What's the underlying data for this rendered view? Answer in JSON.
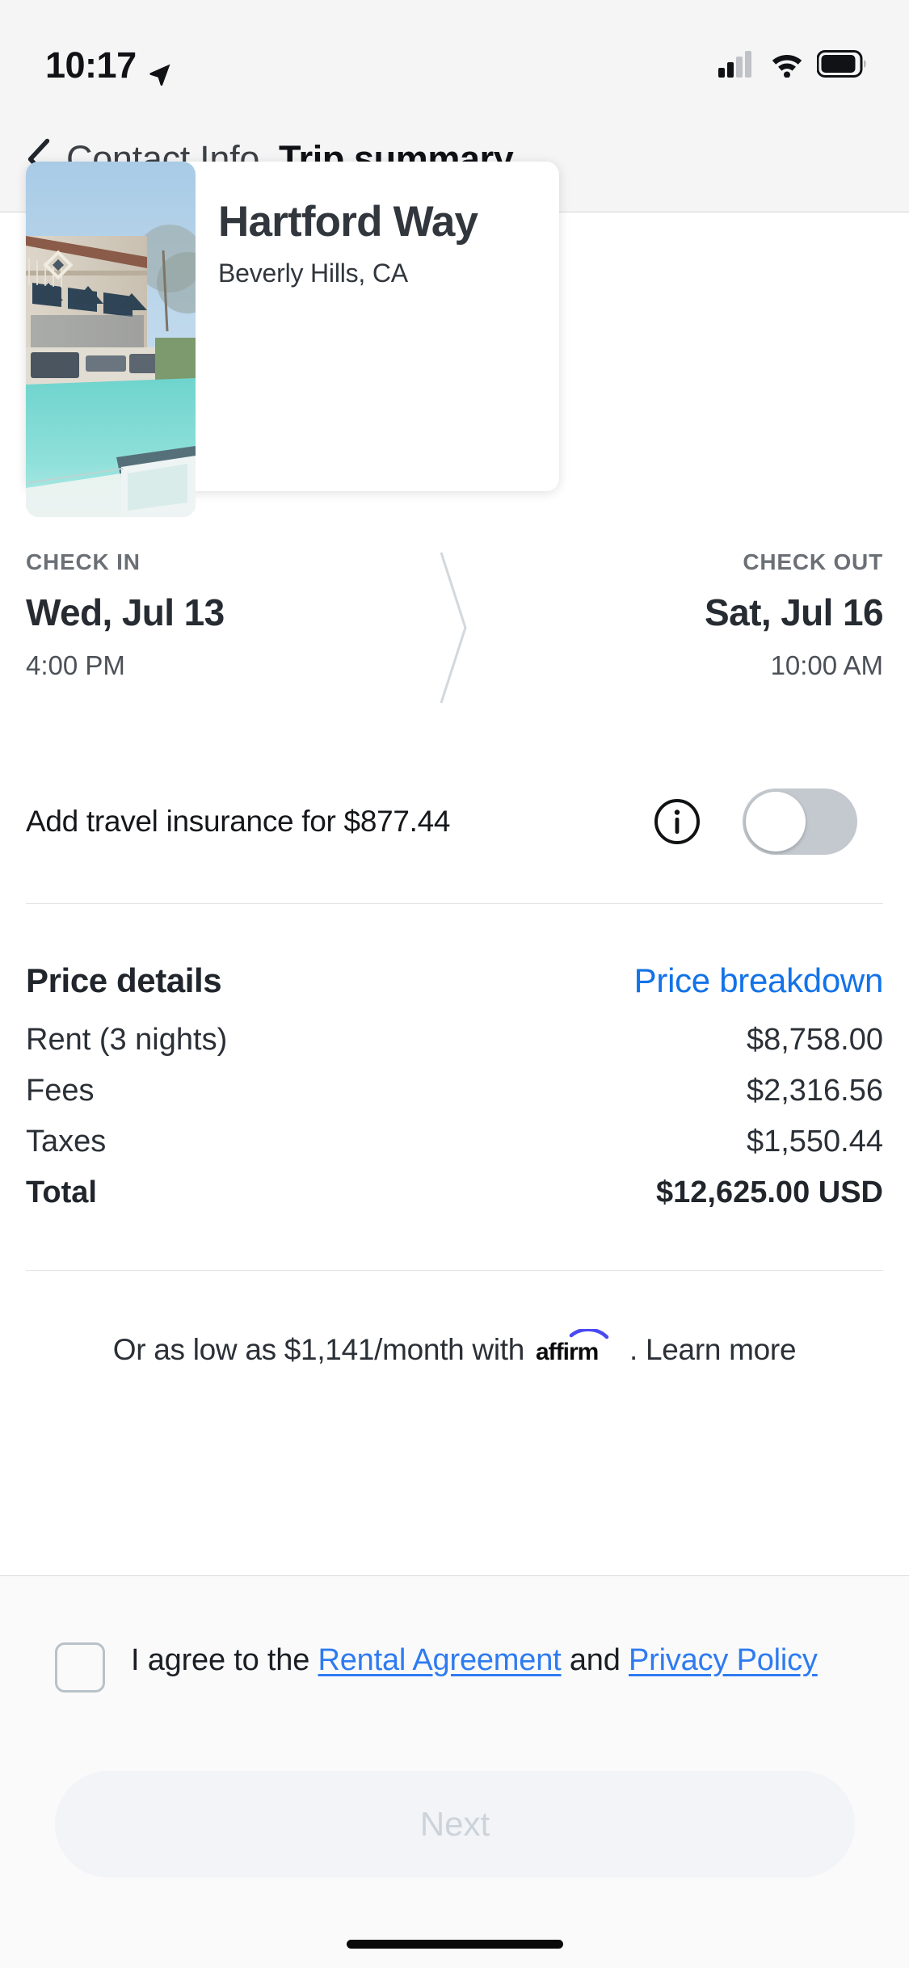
{
  "status_bar": {
    "time": "10:17",
    "location_icon": "location-arrow-icon",
    "signal_icon": "cellular-signal-icon",
    "wifi_icon": "wifi-icon",
    "battery_icon": "battery-icon"
  },
  "nav": {
    "back_icon": "chevron-left-icon",
    "back_label": "Contact Info",
    "title": "Trip summary"
  },
  "property": {
    "photo_alt": "property-photo",
    "name": "Hartford Way",
    "location": "Beverly Hills, CA"
  },
  "dates": {
    "check_in_label": "CHECK IN",
    "check_in_date": "Wed, Jul 13",
    "check_in_time": "4:00 PM",
    "check_out_label": "CHECK OUT",
    "check_out_date": "Sat, Jul 16",
    "check_out_time": "10:00 AM",
    "separator_icon": "chevron-right-divider-icon"
  },
  "insurance": {
    "label": "Add travel insurance for $877.44",
    "info_icon": "info-circle-icon",
    "toggle_icon": "toggle-switch-icon",
    "toggle_state": "off"
  },
  "price": {
    "title": "Price details",
    "breakdown_link": "Price breakdown",
    "breakdown_link_color": "#1272e8",
    "rows": [
      {
        "label": "Rent (3 nights)",
        "value": "$8,758.00"
      },
      {
        "label": "Fees",
        "value": "$2,316.56"
      },
      {
        "label": "Taxes",
        "value": "$1,550.44"
      }
    ],
    "total_label": "Total",
    "total_value": "$12,625.00 USD"
  },
  "financing": {
    "prefix": "Or as low as $1,141/month with",
    "logo_icon": "affirm-logo-icon",
    "logo_text": "affirm",
    "logo_accent_color": "#4a4af4",
    "suffix": ". Learn more"
  },
  "footer": {
    "checkbox_icon": "checkbox-unchecked-icon",
    "checkbox_state": "unchecked",
    "agree_prefix": "I agree to the ",
    "rental_link": "Rental Agreement",
    "agree_middle": " and ",
    "privacy_link": "Privacy Policy",
    "link_color": "#2e7bf0",
    "next_label": "Next",
    "next_state": "disabled",
    "home_indicator": "home-indicator"
  }
}
